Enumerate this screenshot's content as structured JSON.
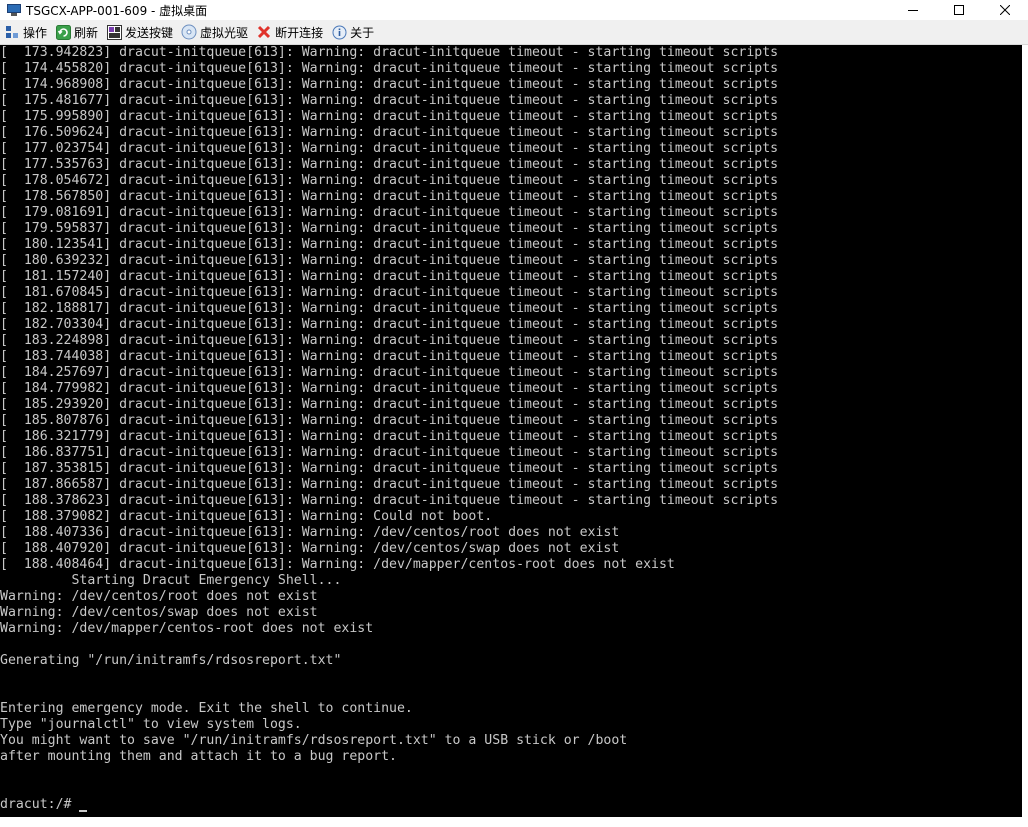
{
  "window": {
    "title": "TSGCX-APP-001-609 - 虚拟桌面",
    "app_icon": "monitor-icon"
  },
  "toolbar": {
    "items": [
      {
        "label": "操作",
        "icon": "actions-icon"
      },
      {
        "label": "刷新",
        "icon": "refresh-icon"
      },
      {
        "label": "发送按键",
        "icon": "keyboard-icon"
      },
      {
        "label": "虚拟光驱",
        "icon": "cdrom-icon"
      },
      {
        "label": "断开连接",
        "icon": "disconnect-icon"
      },
      {
        "label": "关于",
        "icon": "info-icon"
      }
    ]
  },
  "colors": {
    "console_bg": "#000000",
    "console_fg": "#c8c8c8",
    "toolbar_bg": "#f0f0f0",
    "disconnect_red": "#e0322b"
  },
  "console": {
    "lines": [
      "[  173.942823] dracut-initqueue[613]: Warning: dracut-initqueue timeout - starting timeout scripts",
      "[  174.455820] dracut-initqueue[613]: Warning: dracut-initqueue timeout - starting timeout scripts",
      "[  174.968908] dracut-initqueue[613]: Warning: dracut-initqueue timeout - starting timeout scripts",
      "[  175.481677] dracut-initqueue[613]: Warning: dracut-initqueue timeout - starting timeout scripts",
      "[  175.995890] dracut-initqueue[613]: Warning: dracut-initqueue timeout - starting timeout scripts",
      "[  176.509624] dracut-initqueue[613]: Warning: dracut-initqueue timeout - starting timeout scripts",
      "[  177.023754] dracut-initqueue[613]: Warning: dracut-initqueue timeout - starting timeout scripts",
      "[  177.535763] dracut-initqueue[613]: Warning: dracut-initqueue timeout - starting timeout scripts",
      "[  178.054672] dracut-initqueue[613]: Warning: dracut-initqueue timeout - starting timeout scripts",
      "[  178.567850] dracut-initqueue[613]: Warning: dracut-initqueue timeout - starting timeout scripts",
      "[  179.081691] dracut-initqueue[613]: Warning: dracut-initqueue timeout - starting timeout scripts",
      "[  179.595837] dracut-initqueue[613]: Warning: dracut-initqueue timeout - starting timeout scripts",
      "[  180.123541] dracut-initqueue[613]: Warning: dracut-initqueue timeout - starting timeout scripts",
      "[  180.639232] dracut-initqueue[613]: Warning: dracut-initqueue timeout - starting timeout scripts",
      "[  181.157240] dracut-initqueue[613]: Warning: dracut-initqueue timeout - starting timeout scripts",
      "[  181.670845] dracut-initqueue[613]: Warning: dracut-initqueue timeout - starting timeout scripts",
      "[  182.188817] dracut-initqueue[613]: Warning: dracut-initqueue timeout - starting timeout scripts",
      "[  182.703304] dracut-initqueue[613]: Warning: dracut-initqueue timeout - starting timeout scripts",
      "[  183.224898] dracut-initqueue[613]: Warning: dracut-initqueue timeout - starting timeout scripts",
      "[  183.744038] dracut-initqueue[613]: Warning: dracut-initqueue timeout - starting timeout scripts",
      "[  184.257697] dracut-initqueue[613]: Warning: dracut-initqueue timeout - starting timeout scripts",
      "[  184.779982] dracut-initqueue[613]: Warning: dracut-initqueue timeout - starting timeout scripts",
      "[  185.293920] dracut-initqueue[613]: Warning: dracut-initqueue timeout - starting timeout scripts",
      "[  185.807876] dracut-initqueue[613]: Warning: dracut-initqueue timeout - starting timeout scripts",
      "[  186.321779] dracut-initqueue[613]: Warning: dracut-initqueue timeout - starting timeout scripts",
      "[  186.837751] dracut-initqueue[613]: Warning: dracut-initqueue timeout - starting timeout scripts",
      "[  187.353815] dracut-initqueue[613]: Warning: dracut-initqueue timeout - starting timeout scripts",
      "[  187.866587] dracut-initqueue[613]: Warning: dracut-initqueue timeout - starting timeout scripts",
      "[  188.378623] dracut-initqueue[613]: Warning: dracut-initqueue timeout - starting timeout scripts",
      "[  188.379082] dracut-initqueue[613]: Warning: Could not boot.",
      "[  188.407336] dracut-initqueue[613]: Warning: /dev/centos/root does not exist",
      "[  188.407920] dracut-initqueue[613]: Warning: /dev/centos/swap does not exist",
      "[  188.408464] dracut-initqueue[613]: Warning: /dev/mapper/centos-root does not exist",
      "         Starting Dracut Emergency Shell...",
      "Warning: /dev/centos/root does not exist",
      "Warning: /dev/centos/swap does not exist",
      "Warning: /dev/mapper/centos-root does not exist",
      "",
      "Generating \"/run/initramfs/rdsosreport.txt\"",
      "",
      "",
      "Entering emergency mode. Exit the shell to continue.",
      "Type \"journalctl\" to view system logs.",
      "You might want to save \"/run/initramfs/rdsosreport.txt\" to a USB stick or /boot",
      "after mounting them and attach it to a bug report.",
      "",
      ""
    ],
    "prompt": "dracut:/# "
  }
}
